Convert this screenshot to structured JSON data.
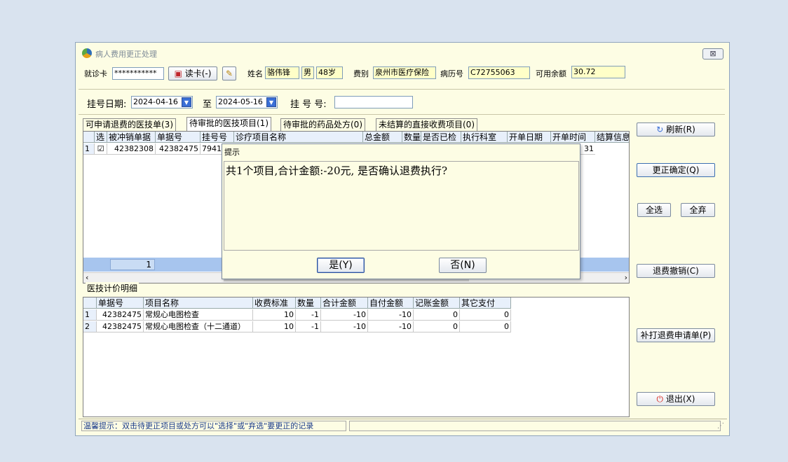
{
  "window": {
    "title": "病人费用更正处理",
    "close": "⊠"
  },
  "patient": {
    "card_label": "就诊卡",
    "card_value": "***********",
    "read_card_btn": "读卡(-)",
    "name_label": "姓名",
    "name": "骆伟锋",
    "sex": "男",
    "age": "48岁",
    "fee_type_label": "费别",
    "fee_type": "泉州市医疗保险",
    "record_no_label": "病历号",
    "record_no": "C72755063",
    "balance_label": "可用余额",
    "balance": "30.72"
  },
  "filter": {
    "date_label": "挂号日期:",
    "date_from": "2024-04-16",
    "to_label": "至",
    "date_to": "2024-05-16",
    "reg_no_label": "挂 号 号:",
    "reg_no_value": ""
  },
  "tabs": [
    "可申请退费的医技单(3)",
    "待审批的医技项目(1)",
    "待审批的药品处方(0)",
    "未结算的直接收费项目(0)"
  ],
  "main_grid": {
    "headers": [
      "选",
      "被冲销单据",
      "单据号",
      "挂号号",
      "诊疗项目名称",
      "总金额",
      "数量",
      "是否已检",
      "执行科室",
      "开单日期",
      "开单时间",
      "结算信息"
    ],
    "rows": [
      {
        "idx": "1",
        "checked": "☑",
        "bill_cancel": "42382308",
        "bill_no": "42382475",
        "reg_no": "79419",
        "end": "31"
      }
    ],
    "footer_count": "1"
  },
  "detail": {
    "title": "医技计价明细",
    "headers": [
      "单据号",
      "项目名称",
      "收费标准",
      "数量",
      "合计金额",
      "自付金额",
      "记账金额",
      "其它支付"
    ],
    "rows": [
      {
        "idx": "1",
        "bill": "42382475",
        "name": "常规心电图检查",
        "std": "10",
        "qty": "-1",
        "total": "-10",
        "self": "-10",
        "acct": "0",
        "other": "0"
      },
      {
        "idx": "2",
        "bill": "42382475",
        "name": "常规心电图检查（十二通道）",
        "std": "10",
        "qty": "-1",
        "total": "-10",
        "self": "-10",
        "acct": "0",
        "other": "0"
      }
    ]
  },
  "side": {
    "refresh": "刷新(R)",
    "confirm": "更正确定(Q)",
    "select_all": "全选",
    "deselect_all": "全弃",
    "cancel_refund": "退费撤销(C)",
    "reprint": "补打退费申请单(P)",
    "exit": "退出(X)"
  },
  "status": {
    "tip": "温馨提示：双击待更正项目或处方可以\"选择\"或\"弃选\"要更正的记录"
  },
  "dialog": {
    "title": "提示",
    "message": "共1个项目,合计金额:-20元, 是否确认退费执行?",
    "yes": "是(Y)",
    "no": "否(N)"
  }
}
